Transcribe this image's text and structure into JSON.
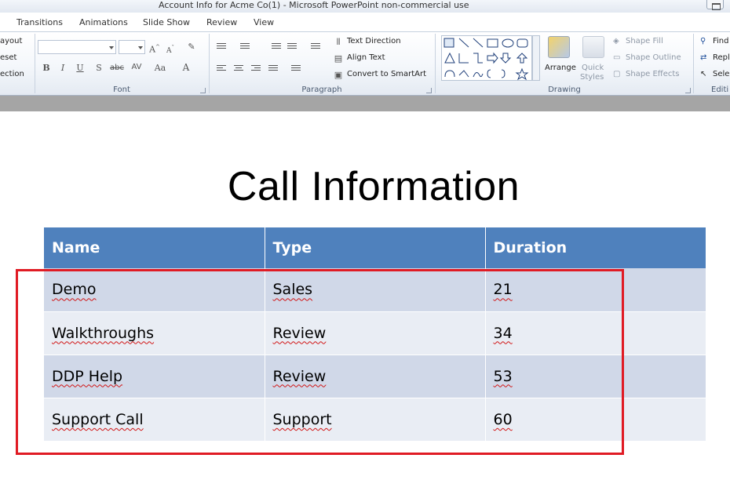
{
  "window": {
    "title": "Account Info for Acme Co(1)  -  Microsoft PowerPoint non-commercial use"
  },
  "tabs": [
    "Transitions",
    "Animations",
    "Slide Show",
    "Review",
    "View"
  ],
  "ribbon": {
    "slides_group": {
      "layout": "ayout",
      "reset": "eset",
      "section": "ection"
    },
    "font_group": {
      "label": "Font",
      "font_name": "",
      "font_size": "",
      "buttons": [
        "B",
        "I",
        "U",
        "S",
        "abc",
        "AV",
        "Aa",
        "A"
      ]
    },
    "paragraph_group": {
      "label": "Paragraph",
      "text_direction": "Text Direction",
      "align_text": "Align Text",
      "convert_smartart": "Convert to SmartArt"
    },
    "drawing_group": {
      "label": "Drawing",
      "arrange": "Arrange",
      "quick_styles_1": "Quick",
      "quick_styles_2": "Styles",
      "shape_fill": "Shape Fill",
      "shape_outline": "Shape Outline",
      "shape_effects": "Shape Effects"
    },
    "editing_group": {
      "label": "Editi",
      "find": "Find",
      "replace": "Repl",
      "select": "Sele"
    }
  },
  "slide": {
    "title": "Call Information",
    "table": {
      "headers": [
        "Name",
        "Type",
        "Duration"
      ],
      "rows": [
        [
          "Demo",
          "Sales",
          "21"
        ],
        [
          "Walkthroughs",
          "Review",
          "34"
        ],
        [
          "DDP Help",
          "Review",
          "53"
        ],
        [
          "Support Call",
          "Support",
          "60"
        ]
      ]
    }
  },
  "colors": {
    "table_header": "#4f81bd",
    "row_odd": "#d0d8e8",
    "row_even": "#e9edf4",
    "highlight": "#e01b24"
  }
}
